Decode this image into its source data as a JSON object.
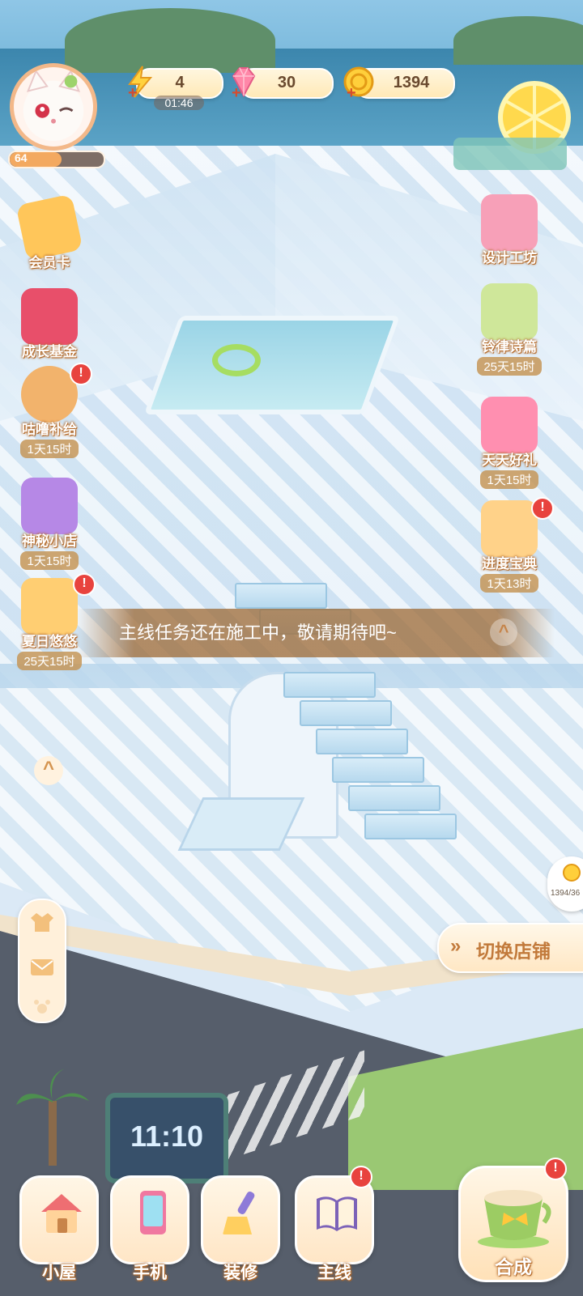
{
  "hud": {
    "level": "64",
    "level_progress": 0.55,
    "energy": "4",
    "energy_timer": "01:46",
    "gems": "30",
    "coins": "1394"
  },
  "left_menu": [
    {
      "label": "会员卡",
      "sub": "",
      "badge": false,
      "icon": "member-card-icon"
    },
    {
      "label": "成长基金",
      "sub": "",
      "badge": false,
      "icon": "gift-box-icon"
    },
    {
      "label": "咕噜补给",
      "sub": "1天15时",
      "badge": true,
      "icon": "cat-supply-icon"
    },
    {
      "label": "神秘小店",
      "sub": "1天15时",
      "badge": false,
      "icon": "treasure-chest-icon"
    },
    {
      "label": "夏日悠悠",
      "sub": "25天15时",
      "badge": true,
      "icon": "summer-cards-icon"
    }
  ],
  "right_menu": [
    {
      "label": "设计工坊",
      "sub": "",
      "badge": false,
      "icon": "pencil-ruler-icon"
    },
    {
      "label": "铃律诗篇",
      "sub": "25天15时",
      "badge": false,
      "icon": "harp-icon"
    },
    {
      "label": "天天好礼",
      "sub": "1天15时",
      "badge": false,
      "icon": "daily-gift-icon"
    },
    {
      "label": "进度宝典",
      "sub": "1天13时",
      "badge": true,
      "icon": "progress-book-icon"
    }
  ],
  "toast": {
    "message": "主线任务还在施工中，敬请期待吧~"
  },
  "switch_shop": {
    "label": "切换店铺"
  },
  "coin_bubble": {
    "text": "1394/36"
  },
  "clock_sign": {
    "text": "11:10"
  },
  "bottom_nav": [
    {
      "label": "小屋",
      "badge": false,
      "icon": "house-icon"
    },
    {
      "label": "手机",
      "badge": false,
      "icon": "phone-icon"
    },
    {
      "label": "装修",
      "badge": false,
      "icon": "brush-icon"
    },
    {
      "label": "主线",
      "badge": true,
      "icon": "quest-book-icon"
    }
  ],
  "merge": {
    "label": "合成",
    "badge": true,
    "icon": "teacup-icon"
  },
  "badge_symbol": "!",
  "chevron_up": "^",
  "colors": {
    "accent": "#f3a960",
    "badge": "#e8433e",
    "text_outline": "#b46a2a"
  }
}
